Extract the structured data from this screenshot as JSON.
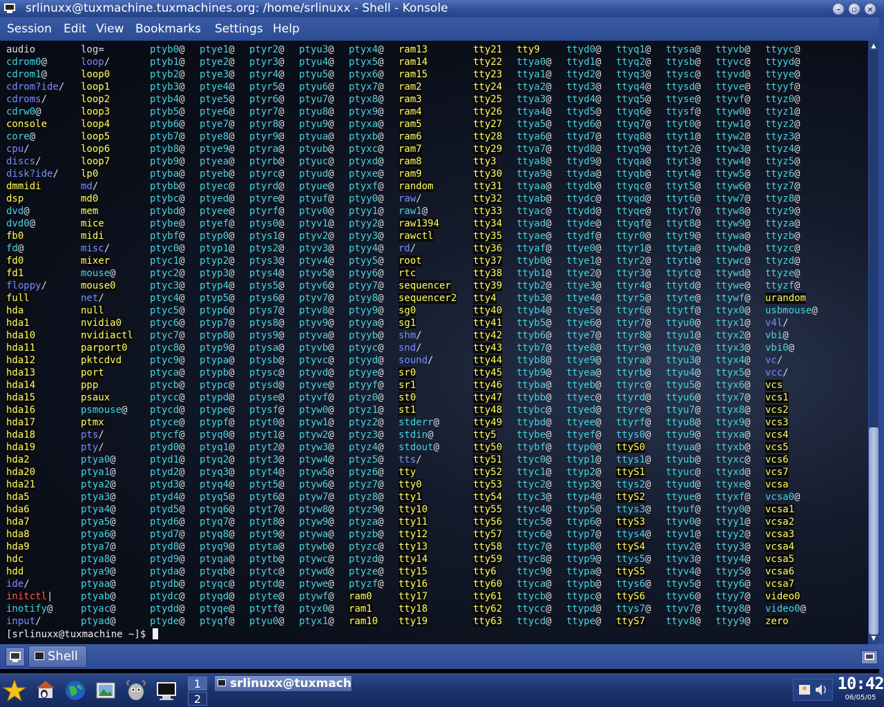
{
  "window": {
    "title": "srlinuxx@tuxmachine.tuxmachines.org: /home/srlinuxx - Shell - Konsole",
    "buttons": [
      "minimize",
      "maximize",
      "close"
    ]
  },
  "menubar": {
    "items": [
      "Session",
      "Edit",
      "View",
      "Bookmarks",
      "Settings",
      "Help"
    ]
  },
  "terminal": {
    "prompt": "[srlinuxx@tuxmachine ~]$ ",
    "legend": {
      "f": "regular-file",
      "d": "directory",
      "l": "symlink",
      "c": "device",
      "b": "broken-link"
    },
    "columns": [
      [
        "audio|f",
        "cdrom0@|l",
        "cdrom1@|l",
        "cdrom?ide/|d",
        "cdroms/|d",
        "cdrw0@|l",
        "console|c",
        "core@|l",
        "cpu/|d",
        "discs/|d",
        "disk?ide/|d",
        "dmmidi|c",
        "dsp|c",
        "dvd@|l",
        "dvd0@|l",
        "fb0|c",
        "fd@|l",
        "fd0|c",
        "fd1|c",
        "floppy/|d",
        "full|c",
        "hda|c",
        "hda1|c",
        "hda10|c",
        "hda11|c",
        "hda12|c",
        "hda13|c",
        "hda14|c",
        "hda15|c",
        "hda16|c",
        "hda17|c",
        "hda18|c",
        "hda19|c",
        "hda2|c",
        "hda20|c",
        "hda21|c",
        "hda5|c",
        "hda6|c",
        "hda7|c",
        "hda8|c",
        "hda9|c",
        "hdc|c",
        "hdd|c",
        "ide/|d",
        "initctl||b",
        "inotify@|l",
        "input/|d"
      ],
      [
        "log=|f",
        "loop/|d",
        "loop0|c",
        "loop1|c",
        "loop2|c",
        "loop3|c",
        "loop4|c",
        "loop5|c",
        "loop6|c",
        "loop7|c",
        "lp0|c",
        "md/|d",
        "md0|c",
        "mem|c",
        "mice|c",
        "midi|c",
        "misc/|d",
        "mixer|c",
        "mouse@|l",
        "mouse0|c",
        "net/|d",
        "null|c",
        "nvidia0|c",
        "nvidiactl|c",
        "parport0|c",
        "pktcdvd|c",
        "port|c",
        "ppp|c",
        "psaux|c",
        "psmouse@|l",
        "ptmx|c",
        "pts/|d",
        "pty/|d",
        "ptya0@|l",
        "ptya1@|l",
        "ptya2@|l",
        "ptya3@|l",
        "ptya4@|l",
        "ptya5@|l",
        "ptya6@|l",
        "ptya7@|l",
        "ptya8@|l",
        "ptya9@|l",
        "ptyaa@|l",
        "ptyab@|l",
        "ptyac@|l",
        "ptyad@|l"
      ],
      [
        "ptyb0@|l",
        "ptyb1@|l",
        "ptyb2@|l",
        "ptyb3@|l",
        "ptyb4@|l",
        "ptyb5@|l",
        "ptyb6@|l",
        "ptyb7@|l",
        "ptyb8@|l",
        "ptyb9@|l",
        "ptyba@|l",
        "ptybb@|l",
        "ptybc@|l",
        "ptybd@|l",
        "ptybe@|l",
        "ptybf@|l",
        "ptyc0@|l",
        "ptyc1@|l",
        "ptyc2@|l",
        "ptyc3@|l",
        "ptyc4@|l",
        "ptyc5@|l",
        "ptyc6@|l",
        "ptyc7@|l",
        "ptyc8@|l",
        "ptyc9@|l",
        "ptyca@|l",
        "ptycb@|l",
        "ptycc@|l",
        "ptycd@|l",
        "ptyce@|l",
        "ptycf@|l",
        "ptyd0@|l",
        "ptyd1@|l",
        "ptyd2@|l",
        "ptyd3@|l",
        "ptyd4@|l",
        "ptyd5@|l",
        "ptyd6@|l",
        "ptyd7@|l",
        "ptyd8@|l",
        "ptyd9@|l",
        "ptyda@|l",
        "ptydb@|l",
        "ptydc@|l",
        "ptydd@|l",
        "ptyde@|l"
      ],
      [
        "ptye1@|l",
        "ptye2@|l",
        "ptye3@|l",
        "ptye4@|l",
        "ptye5@|l",
        "ptye6@|l",
        "ptye7@|l",
        "ptye8@|l",
        "ptye9@|l",
        "ptyea@|l",
        "ptyeb@|l",
        "ptyec@|l",
        "ptyed@|l",
        "ptyee@|l",
        "ptyef@|l",
        "ptyp0@|l",
        "ptyp1@|l",
        "ptyp2@|l",
        "ptyp3@|l",
        "ptyp4@|l",
        "ptyp5@|l",
        "ptyp6@|l",
        "ptyp7@|l",
        "ptyp8@|l",
        "ptyp9@|l",
        "ptypa@|l",
        "ptypb@|l",
        "ptypc@|l",
        "ptypd@|l",
        "ptype@|l",
        "ptypf@|l",
        "ptyq0@|l",
        "ptyq1@|l",
        "ptyq2@|l",
        "ptyq3@|l",
        "ptyq4@|l",
        "ptyq5@|l",
        "ptyq6@|l",
        "ptyq7@|l",
        "ptyq8@|l",
        "ptyq9@|l",
        "ptyqa@|l",
        "ptyqb@|l",
        "ptyqc@|l",
        "ptyqd@|l",
        "ptyqe@|l",
        "ptyqf@|l"
      ],
      [
        "ptyr2@|l",
        "ptyr3@|l",
        "ptyr4@|l",
        "ptyr5@|l",
        "ptyr6@|l",
        "ptyr7@|l",
        "ptyr8@|l",
        "ptyr9@|l",
        "ptyra@|l",
        "ptyrb@|l",
        "ptyrc@|l",
        "ptyrd@|l",
        "ptyre@|l",
        "ptyrf@|l",
        "ptys0@|l",
        "ptys1@|l",
        "ptys2@|l",
        "ptys3@|l",
        "ptys4@|l",
        "ptys5@|l",
        "ptys6@|l",
        "ptys7@|l",
        "ptys8@|l",
        "ptys9@|l",
        "ptysa@|l",
        "ptysb@|l",
        "ptysc@|l",
        "ptysd@|l",
        "ptyse@|l",
        "ptysf@|l",
        "ptyt0@|l",
        "ptyt1@|l",
        "ptyt2@|l",
        "ptyt3@|l",
        "ptyt4@|l",
        "ptyt5@|l",
        "ptyt6@|l",
        "ptyt7@|l",
        "ptyt8@|l",
        "ptyt9@|l",
        "ptyta@|l",
        "ptytb@|l",
        "ptytc@|l",
        "ptytd@|l",
        "ptyte@|l",
        "ptytf@|l",
        "ptyu0@|l"
      ],
      [
        "ptyu3@|l",
        "ptyu4@|l",
        "ptyu5@|l",
        "ptyu6@|l",
        "ptyu7@|l",
        "ptyu8@|l",
        "ptyu9@|l",
        "ptyua@|l",
        "ptyub@|l",
        "ptyuc@|l",
        "ptyud@|l",
        "ptyue@|l",
        "ptyuf@|l",
        "ptyv0@|l",
        "ptyv1@|l",
        "ptyv2@|l",
        "ptyv3@|l",
        "ptyv4@|l",
        "ptyv5@|l",
        "ptyv6@|l",
        "ptyv7@|l",
        "ptyv8@|l",
        "ptyv9@|l",
        "ptyva@|l",
        "ptyvb@|l",
        "ptyvc@|l",
        "ptyvd@|l",
        "ptyve@|l",
        "ptyvf@|l",
        "ptyw0@|l",
        "ptyw1@|l",
        "ptyw2@|l",
        "ptyw3@|l",
        "ptyw4@|l",
        "ptyw5@|l",
        "ptyw6@|l",
        "ptyw7@|l",
        "ptyw8@|l",
        "ptyw9@|l",
        "ptywa@|l",
        "ptywb@|l",
        "ptywc@|l",
        "ptywd@|l",
        "ptywe@|l",
        "ptywf@|l",
        "ptyx0@|l",
        "ptyx1@|l"
      ],
      [
        "ptyx4@|l",
        "ptyx5@|l",
        "ptyx6@|l",
        "ptyx7@|l",
        "ptyx8@|l",
        "ptyx9@|l",
        "ptyxa@|l",
        "ptyxb@|l",
        "ptyxc@|l",
        "ptyxd@|l",
        "ptyxe@|l",
        "ptyxf@|l",
        "ptyy0@|l",
        "ptyy1@|l",
        "ptyy2@|l",
        "ptyy3@|l",
        "ptyy4@|l",
        "ptyy5@|l",
        "ptyy6@|l",
        "ptyy7@|l",
        "ptyy8@|l",
        "ptyy9@|l",
        "ptyya@|l",
        "ptyyb@|l",
        "ptyyc@|l",
        "ptyyd@|l",
        "ptyye@|l",
        "ptyyf@|l",
        "ptyz0@|l",
        "ptyz1@|l",
        "ptyz2@|l",
        "ptyz3@|l",
        "ptyz4@|l",
        "ptyz5@|l",
        "ptyz6@|l",
        "ptyz7@|l",
        "ptyz8@|l",
        "ptyz9@|l",
        "ptyza@|l",
        "ptyzb@|l",
        "ptyzc@|l",
        "ptyzd@|l",
        "ptyze@|l",
        "ptyzf@|l",
        "ram0|c",
        "ram1|c",
        "ram10|c"
      ],
      [
        "ram13|c",
        "ram14|c",
        "ram15|c",
        "ram2|c",
        "ram3|c",
        "ram4|c",
        "ram5|c",
        "ram6|c",
        "ram7|c",
        "ram8|c",
        "ram9|c",
        "random|c",
        "raw/|d",
        "raw1@|l",
        "raw1394|c",
        "rawctl|c",
        "rd/|d",
        "root|c",
        "rtc|c",
        "sequencer|c",
        "sequencer2|c",
        "sg0|c",
        "sg1|c",
        "shm/|d",
        "snd/|d",
        "sound/|d",
        "sr0|c",
        "sr1|c",
        "st0|c",
        "st1|c",
        "stderr@|l",
        "stdin@|l",
        "stdout@|l",
        "tts/|d",
        "tty|c",
        "tty0|c",
        "tty1|c",
        "tty10|c",
        "tty11|c",
        "tty12|c",
        "tty13|c",
        "tty14|c",
        "tty15|c",
        "tty16|c",
        "tty17|c",
        "tty18|c",
        "tty19|c"
      ],
      [
        "tty21|c",
        "tty22|c",
        "tty23|c",
        "tty24|c",
        "tty25|c",
        "tty26|c",
        "tty27|c",
        "tty28|c",
        "tty29|c",
        "tty3|c",
        "tty30|c",
        "tty31|c",
        "tty32|c",
        "tty33|c",
        "tty34|c",
        "tty35|c",
        "tty36|c",
        "tty37|c",
        "tty38|c",
        "tty39|c",
        "tty4|c",
        "tty40|c",
        "tty41|c",
        "tty42|c",
        "tty43|c",
        "tty44|c",
        "tty45|c",
        "tty46|c",
        "tty47|c",
        "tty48|c",
        "tty49|c",
        "tty5|c",
        "tty50|c",
        "tty51|c",
        "tty52|c",
        "tty53|c",
        "tty54|c",
        "tty55|c",
        "tty56|c",
        "tty57|c",
        "tty58|c",
        "tty59|c",
        "tty6|c",
        "tty60|c",
        "tty61|c",
        "tty62|c",
        "tty63|c"
      ],
      [
        "tty9|c",
        "ttya0@|l",
        "ttya1@|l",
        "ttya2@|l",
        "ttya3@|l",
        "ttya4@|l",
        "ttya5@|l",
        "ttya6@|l",
        "ttya7@|l",
        "ttya8@|l",
        "ttya9@|l",
        "ttyaa@|l",
        "ttyab@|l",
        "ttyac@|l",
        "ttyad@|l",
        "ttyae@|l",
        "ttyaf@|l",
        "ttyb0@|l",
        "ttyb1@|l",
        "ttyb2@|l",
        "ttyb3@|l",
        "ttyb4@|l",
        "ttyb5@|l",
        "ttyb6@|l",
        "ttyb7@|l",
        "ttyb8@|l",
        "ttyb9@|l",
        "ttyba@|l",
        "ttybb@|l",
        "ttybc@|l",
        "ttybd@|l",
        "ttybe@|l",
        "ttybf@|l",
        "ttyc0@|l",
        "ttyc1@|l",
        "ttyc2@|l",
        "ttyc3@|l",
        "ttyc4@|l",
        "ttyc5@|l",
        "ttyc6@|l",
        "ttyc7@|l",
        "ttyc8@|l",
        "ttyc9@|l",
        "ttyca@|l",
        "ttycb@|l",
        "ttycc@|l",
        "ttycd@|l"
      ],
      [
        "ttyd0@|l",
        "ttyd1@|l",
        "ttyd2@|l",
        "ttyd3@|l",
        "ttyd4@|l",
        "ttyd5@|l",
        "ttyd6@|l",
        "ttyd7@|l",
        "ttyd8@|l",
        "ttyd9@|l",
        "ttyda@|l",
        "ttydb@|l",
        "ttydc@|l",
        "ttydd@|l",
        "ttyde@|l",
        "ttydf@|l",
        "ttye0@|l",
        "ttye1@|l",
        "ttye2@|l",
        "ttye3@|l",
        "ttye4@|l",
        "ttye5@|l",
        "ttye6@|l",
        "ttye7@|l",
        "ttye8@|l",
        "ttye9@|l",
        "ttyea@|l",
        "ttyeb@|l",
        "ttyec@|l",
        "ttyed@|l",
        "ttyee@|l",
        "ttyef@|l",
        "ttyp0@|l",
        "ttyp1@|l",
        "ttyp2@|l",
        "ttyp3@|l",
        "ttyp4@|l",
        "ttyp5@|l",
        "ttyp6@|l",
        "ttyp7@|l",
        "ttyp8@|l",
        "ttyp9@|l",
        "ttypa@|l",
        "ttypb@|l",
        "ttypc@|l",
        "ttypd@|l",
        "ttype@|l"
      ],
      [
        "ttyq1@|l",
        "ttyq2@|l",
        "ttyq3@|l",
        "ttyq4@|l",
        "ttyq5@|l",
        "ttyq6@|l",
        "ttyq7@|l",
        "ttyq8@|l",
        "ttyq9@|l",
        "ttyqa@|l",
        "ttyqb@|l",
        "ttyqc@|l",
        "ttyqd@|l",
        "ttyqe@|l",
        "ttyqf@|l",
        "ttyr0@|l",
        "ttyr1@|l",
        "ttyr2@|l",
        "ttyr3@|l",
        "ttyr4@|l",
        "ttyr5@|l",
        "ttyr6@|l",
        "ttyr7@|l",
        "ttyr8@|l",
        "ttyr9@|l",
        "ttyra@|l",
        "ttyrb@|l",
        "ttyrc@|l",
        "ttyrd@|l",
        "ttyre@|l",
        "ttyrf@|l",
        "ttys0@|l",
        "ttyS0|c",
        "ttys1@|l",
        "ttyS1|c",
        "ttys2@|l",
        "ttyS2|c",
        "ttys3@|l",
        "ttyS3|c",
        "ttys4@|l",
        "ttyS4|c",
        "ttys5@|l",
        "ttyS5|c",
        "ttys6@|l",
        "ttyS6|c",
        "ttys7@|l",
        "ttyS7|c"
      ],
      [
        "ttysa@|l",
        "ttysb@|l",
        "ttysc@|l",
        "ttysd@|l",
        "ttyse@|l",
        "ttysf@|l",
        "ttyt0@|l",
        "ttyt1@|l",
        "ttyt2@|l",
        "ttyt3@|l",
        "ttyt4@|l",
        "ttyt5@|l",
        "ttyt6@|l",
        "ttyt7@|l",
        "ttyt8@|l",
        "ttyt9@|l",
        "ttyta@|l",
        "ttytb@|l",
        "ttytc@|l",
        "ttytd@|l",
        "ttyte@|l",
        "ttytf@|l",
        "ttyu0@|l",
        "ttyu1@|l",
        "ttyu2@|l",
        "ttyu3@|l",
        "ttyu4@|l",
        "ttyu5@|l",
        "ttyu6@|l",
        "ttyu7@|l",
        "ttyu8@|l",
        "ttyu9@|l",
        "ttyua@|l",
        "ttyub@|l",
        "ttyuc@|l",
        "ttyud@|l",
        "ttyue@|l",
        "ttyuf@|l",
        "ttyv0@|l",
        "ttyv1@|l",
        "ttyv2@|l",
        "ttyv3@|l",
        "ttyv4@|l",
        "ttyv5@|l",
        "ttyv6@|l",
        "ttyv7@|l",
        "ttyv8@|l"
      ],
      [
        "ttyvb@|l",
        "ttyvc@|l",
        "ttyvd@|l",
        "ttyve@|l",
        "ttyvf@|l",
        "ttyw0@|l",
        "ttyw1@|l",
        "ttyw2@|l",
        "ttyw3@|l",
        "ttyw4@|l",
        "ttyw5@|l",
        "ttyw6@|l",
        "ttyw7@|l",
        "ttyw8@|l",
        "ttyw9@|l",
        "ttywa@|l",
        "ttywb@|l",
        "ttywc@|l",
        "ttywd@|l",
        "ttywe@|l",
        "ttywf@|l",
        "ttyx0@|l",
        "ttyx1@|l",
        "ttyx2@|l",
        "ttyx3@|l",
        "ttyx4@|l",
        "ttyx5@|l",
        "ttyx6@|l",
        "ttyx7@|l",
        "ttyx8@|l",
        "ttyx9@|l",
        "ttyxa@|l",
        "ttyxb@|l",
        "ttyxc@|l",
        "ttyxd@|l",
        "ttyxe@|l",
        "ttyxf@|l",
        "ttyy0@|l",
        "ttyy1@|l",
        "ttyy2@|l",
        "ttyy3@|l",
        "ttyy4@|l",
        "ttyy5@|l",
        "ttyy6@|l",
        "ttyy7@|l",
        "ttyy8@|l",
        "ttyy9@|l"
      ],
      [
        "ttyyc@|l",
        "ttyyd@|l",
        "ttyye@|l",
        "ttyyf@|l",
        "ttyz0@|l",
        "ttyz1@|l",
        "ttyz2@|l",
        "ttyz3@|l",
        "ttyz4@|l",
        "ttyz5@|l",
        "ttyz6@|l",
        "ttyz7@|l",
        "ttyz8@|l",
        "ttyz9@|l",
        "ttyza@|l",
        "ttyzb@|l",
        "ttyzc@|l",
        "ttyzd@|l",
        "ttyze@|l",
        "ttyzf@|l",
        "urandom|c",
        "usbmouse@|l",
        "v4l/|d",
        "vbi@|l",
        "vbi0@|l",
        "vc/|d",
        "vcc/|d",
        "vcs|c",
        "vcs1|c",
        "vcs2|c",
        "vcs3|c",
        "vcs4|c",
        "vcs5|c",
        "vcs6|c",
        "vcs7|c",
        "vcsa|c",
        "vcsa0@|l",
        "vcsa1|c",
        "vcsa2|c",
        "vcsa3|c",
        "vcsa4|c",
        "vcsa5|c",
        "vcsa6|c",
        "vcsa7|c",
        "video0|c",
        "video0@|l",
        "zero|c"
      ]
    ]
  },
  "tabbar": {
    "tab_label": "Shell"
  },
  "panel": {
    "pager": [
      "1",
      "2"
    ],
    "task_title": "srlinuxx@tuxmach",
    "clock_time": "10:42",
    "clock_date": "06/05/05"
  }
}
